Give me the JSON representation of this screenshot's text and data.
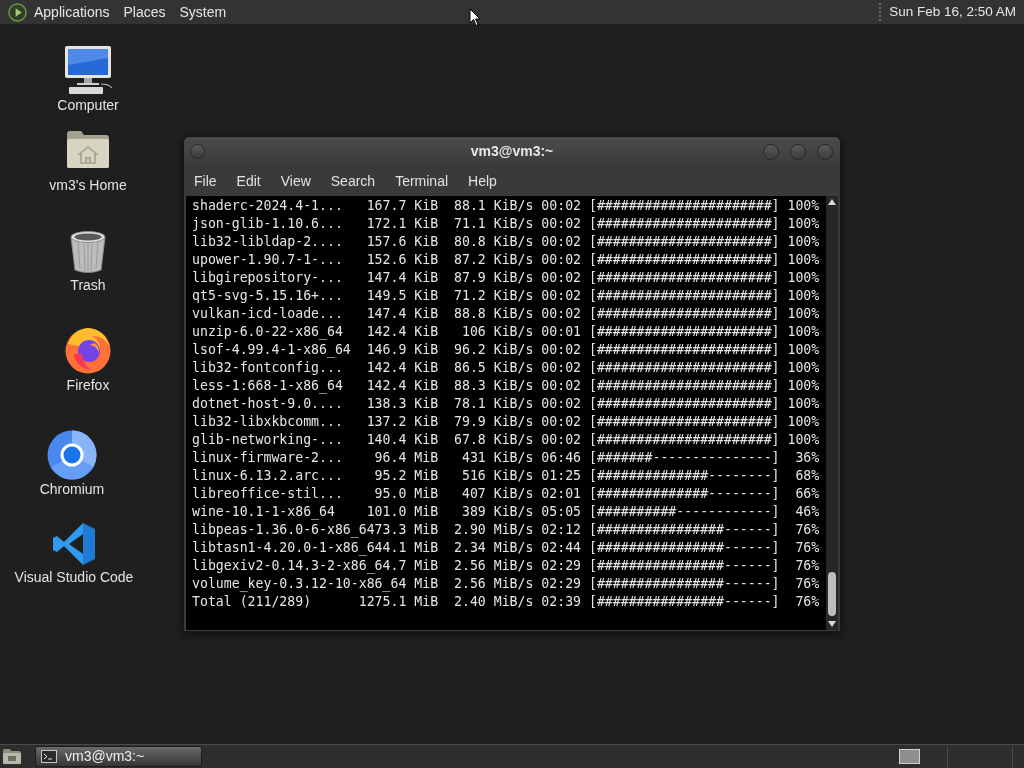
{
  "top_panel": {
    "menus": [
      "Applications",
      "Places",
      "System"
    ],
    "clock": "Sun Feb 16, 2:50 AM"
  },
  "desktop_icons": [
    {
      "kind": "computer",
      "label": "Computer"
    },
    {
      "kind": "home",
      "label": "vm3's Home"
    },
    {
      "kind": "trash",
      "label": "Trash"
    },
    {
      "kind": "firefox",
      "label": "Firefox"
    },
    {
      "kind": "chromium",
      "label": "Chromium"
    },
    {
      "kind": "vscode",
      "label": "Visual Studio Code"
    }
  ],
  "terminal_window": {
    "title": "vm3@vm3:~",
    "menu": [
      "File",
      "Edit",
      "View",
      "Search",
      "Terminal",
      "Help"
    ],
    "lines": [
      "shaderc-2024.4-1...   167.7 KiB  88.1 KiB/s 00:02 [######################] 100%",
      "json-glib-1.10.6...   172.1 KiB  71.1 KiB/s 00:02 [######################] 100%",
      "lib32-libldap-2....   157.6 KiB  80.8 KiB/s 00:02 [######################] 100%",
      "upower-1.90.7-1-...   152.6 KiB  87.2 KiB/s 00:02 [######################] 100%",
      "libgirepository-...   147.4 KiB  87.9 KiB/s 00:02 [######################] 100%",
      "qt5-svg-5.15.16+...   149.5 KiB  71.2 KiB/s 00:02 [######################] 100%",
      "vulkan-icd-loade...   147.4 KiB  88.8 KiB/s 00:02 [######################] 100%",
      "unzip-6.0-22-x86_64   142.4 KiB   106 KiB/s 00:01 [######################] 100%",
      "lsof-4.99.4-1-x86_64  146.9 KiB  96.2 KiB/s 00:02 [######################] 100%",
      "lib32-fontconfig...   142.4 KiB  86.5 KiB/s 00:02 [######################] 100%",
      "less-1:668-1-x86_64   142.4 KiB  88.3 KiB/s 00:02 [######################] 100%",
      "dotnet-host-9.0....   138.3 KiB  78.1 KiB/s 00:02 [######################] 100%",
      "lib32-libxkbcomm...   137.2 KiB  79.9 KiB/s 00:02 [######################] 100%",
      "glib-networking-...   140.4 KiB  67.8 KiB/s 00:02 [######################] 100%",
      "linux-firmware-2...    96.4 MiB   431 KiB/s 06:46 [#######---------------]  36%",
      "linux-6.13.2.arc...    95.2 MiB   516 KiB/s 01:25 [##############--------]  68%",
      "libreoffice-stil...    95.0 MiB   407 KiB/s 02:01 [##############--------]  66%",
      "wine-10.1-1-x86_64    101.0 MiB   389 KiB/s 05:05 [##########------------]  46%",
      "libpeas-1.36.0-6-x86_6473.3 MiB  2.90 MiB/s 02:12 [################------]  76%",
      "libtasn1-4.20.0-1-x86_644.1 MiB  2.34 MiB/s 02:44 [################------]  76%",
      "libgexiv2-0.14.3-2-x86_64.7 MiB  2.56 MiB/s 02:29 [################------]  76%",
      "volume_key-0.3.12-10-x86_64 MiB  2.56 MiB/s 02:29 [################------]  76%",
      "Total (211/289)      1275.1 MiB  2.40 MiB/s 02:39 [################------]  76%"
    ]
  },
  "taskbar": {
    "tasks": [
      {
        "label": "vm3@vm3:~",
        "selected": true
      }
    ]
  }
}
